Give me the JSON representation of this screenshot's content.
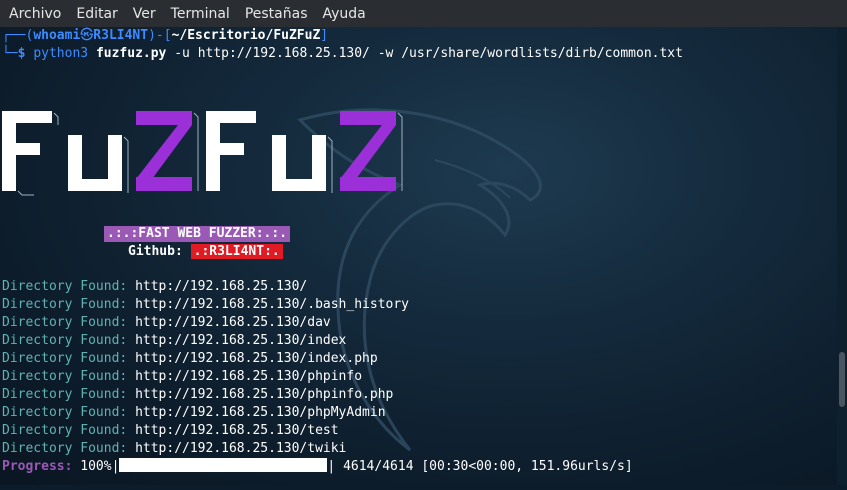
{
  "menu": [
    "Archivo",
    "Editar",
    "Ver",
    "Terminal",
    "Pestañas",
    "Ayuda"
  ],
  "prompt": {
    "user": "whoami",
    "host": "R3LI4NT",
    "path": "~/Escritorio/FuZFuZ",
    "command": "python3",
    "script": "fuzfuz.py",
    "args": "-u http://192.168.25.130/ -w /usr/share/wordlists/dirb/common.txt"
  },
  "logo_text": "FuZFuZ",
  "tagline": ".:.:FAST WEB FUZZER:.:.",
  "github": {
    "label": "Github:",
    "handle": ".:R3LI4NT:."
  },
  "found_label": "Directory Found:",
  "results": [
    "http://192.168.25.130/",
    "http://192.168.25.130/.bash_history",
    "http://192.168.25.130/dav",
    "http://192.168.25.130/index",
    "http://192.168.25.130/index.php",
    "http://192.168.25.130/phpinfo",
    "http://192.168.25.130/phpinfo.php",
    "http://192.168.25.130/phpMyAdmin",
    "http://192.168.25.130/test",
    "http://192.168.25.130/twiki"
  ],
  "progress": {
    "label": "Progress:",
    "percent": "100%",
    "fraction": 1.0,
    "count": "4614/4614",
    "timing": "[00:30<00:00, 151.96urls/s]"
  },
  "colors": {
    "background": "#0c1c2b",
    "logo_white": "#ffffff",
    "logo_purple": "#9b30d9",
    "prompt_blue": "#3d8bff",
    "found_teal": "#5fb3b3",
    "tagline_bg": "#9b59b6",
    "github_bg": "#e01b24"
  }
}
